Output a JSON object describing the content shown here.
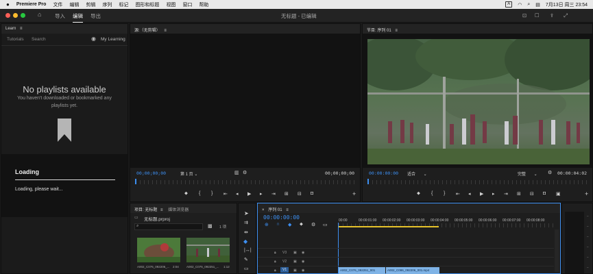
{
  "menubar": {
    "app_name": "Premiere Pro",
    "items": [
      "文件",
      "编辑",
      "剪辑",
      "序列",
      "标记",
      "图形和标题",
      "视图",
      "窗口",
      "帮助"
    ],
    "input_method": "A",
    "datetime": "7月13日 周三 23:54"
  },
  "titlebar": {
    "workspaces": [
      "导入",
      "编辑",
      "导出"
    ],
    "active_workspace": "编辑",
    "document_title": "无标题 - 已编辑"
  },
  "learn": {
    "panel_title": "Learn",
    "tabs": [
      "Tutorials",
      "Search"
    ],
    "my_learning": "My Learning",
    "empty_title": "No playlists available",
    "empty_text": "You haven't downloaded or bookmarked any playlists yet.",
    "loading_title": "Loading",
    "loading_text": "Loading, please wait..."
  },
  "source_monitor": {
    "title": "源:（无剪辑）",
    "timecode_in": "00;00;00;00",
    "page": "第 1 页",
    "timecode_out": "00;00;00;00"
  },
  "program_monitor": {
    "title": "节目: 序列 01",
    "timecode_in": "00:00:00:00",
    "fit": "适合",
    "quality": "完整",
    "timecode_out": "00:00:04:02"
  },
  "project": {
    "tabs": [
      "项目: 无标题",
      "媒体浏览器"
    ],
    "file": "无标题.prproj",
    "count": "1 项",
    "clips": [
      {
        "name": "A002_C076_092206_...",
        "duration": "2:04"
      },
      {
        "name": "A002_C076_092251_...",
        "duration": "1:12"
      }
    ]
  },
  "timeline": {
    "tab": "序列 01",
    "timecode": "00:00:00:00",
    "ruler_labels": [
      "00:00",
      "00:00:01:00",
      "00:00:02:00",
      "00:00:03:00",
      "00:00:04:00",
      "00:00:05:00",
      "00:00:06:00",
      "00:00:07:00",
      "00:00:08:00"
    ],
    "tracks": [
      "V3",
      "V2",
      "V1"
    ],
    "clips": [
      "A002_C076_092251_001",
      "A002_C086_092206_001.mp4"
    ]
  },
  "colors": {
    "accent": "#3d8ff1",
    "playhead": "#3d8ff1",
    "clip": "#7fb3e6",
    "close": "#ff5f57",
    "minimize": "#febc2e",
    "zoom": "#28c840"
  }
}
